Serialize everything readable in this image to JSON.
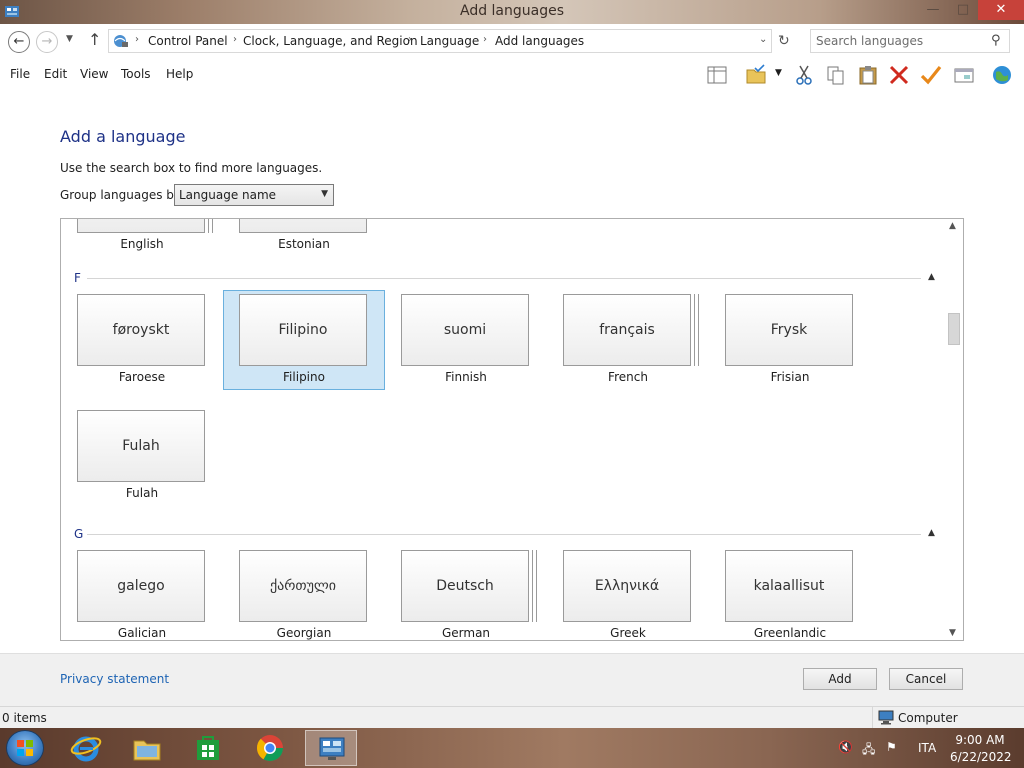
{
  "window": {
    "title": "Add languages",
    "min": "—",
    "max": "□",
    "close": "✕"
  },
  "address": {
    "crumbs": [
      "Control Panel",
      "Clock, Language, and Region",
      "Language",
      "Add languages"
    ],
    "search_placeholder": "Search languages"
  },
  "menu": [
    "File",
    "Edit",
    "View",
    "Tools",
    "Help"
  ],
  "content": {
    "heading": "Add a language",
    "hint": "Use the search box to find more languages.",
    "group_label": "Group languages by:",
    "group_value": "Language name"
  },
  "sections": {
    "top_partial": [
      {
        "name": "English"
      },
      {
        "name": "Estonian"
      }
    ],
    "F": {
      "letter": "F",
      "tiles": [
        {
          "native": "føroyskt",
          "name": "Faroese"
        },
        {
          "native": "Filipino",
          "name": "Filipino",
          "selected": true
        },
        {
          "native": "suomi",
          "name": "Finnish"
        },
        {
          "native": "français",
          "name": "French",
          "stacked": true
        },
        {
          "native": "Frysk",
          "name": "Frisian"
        },
        {
          "native": "Fulah",
          "name": "Fulah"
        }
      ]
    },
    "G": {
      "letter": "G",
      "tiles": [
        {
          "native": "galego",
          "name": "Galician"
        },
        {
          "native": "ქართული",
          "name": "Georgian"
        },
        {
          "native": "Deutsch",
          "name": "German",
          "stacked": true
        },
        {
          "native": "Ελληνικά",
          "name": "Greek"
        },
        {
          "native": "kalaallisut",
          "name": "Greenlandic"
        }
      ]
    }
  },
  "footer": {
    "privacy": "Privacy statement",
    "add": "Add",
    "cancel": "Cancel"
  },
  "status": {
    "count": "0 items",
    "zone": "Computer"
  },
  "taskbar": {
    "lang": "ITA",
    "time": "9:00 AM",
    "date": "6/22/2022"
  }
}
